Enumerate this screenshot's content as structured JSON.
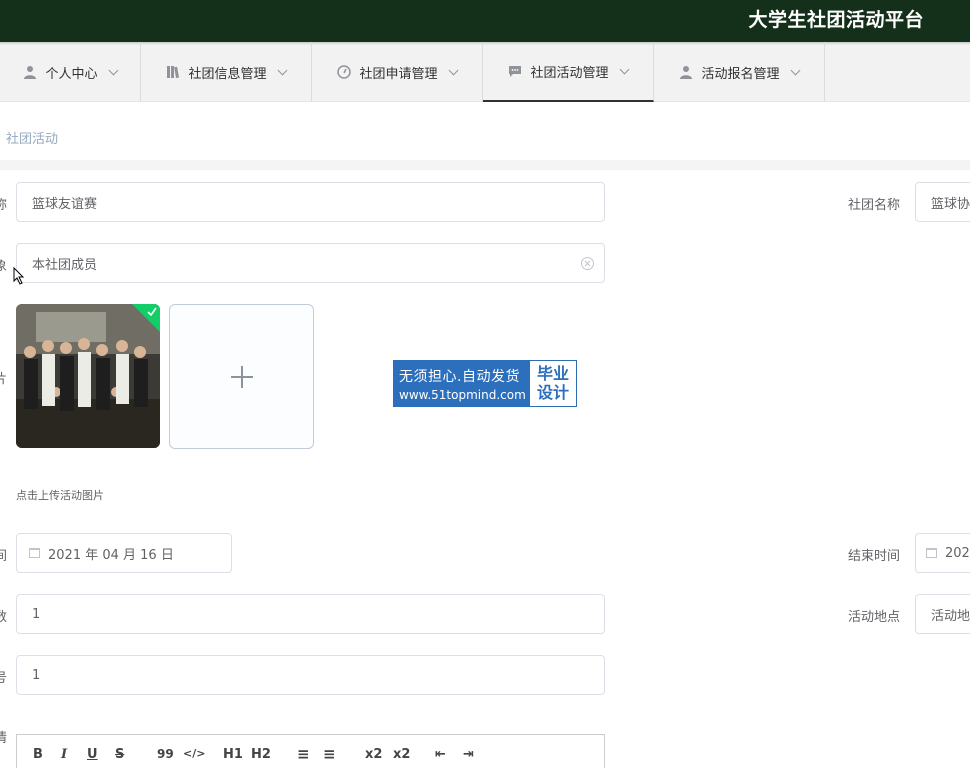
{
  "app": {
    "title": "大学生社团活动平台"
  },
  "nav": {
    "items": [
      {
        "label": "个人中心",
        "icon": "user-icon"
      },
      {
        "label": "社团信息管理",
        "icon": "book-icon"
      },
      {
        "label": "社团申请管理",
        "icon": "gauge-icon"
      },
      {
        "label": "社团活动管理",
        "icon": "chat-icon",
        "active": true
      },
      {
        "label": "活动报名管理",
        "icon": "user-icon"
      }
    ]
  },
  "breadcrumb": {
    "current": "社团活动"
  },
  "form": {
    "activity_name": {
      "label": "称",
      "value": "篮球友谊赛"
    },
    "club_name": {
      "label": "社团名称",
      "value": "篮球协"
    },
    "target": {
      "label": "象",
      "value": "本社团成员"
    },
    "image": {
      "label": "片",
      "hint": "点击上传活动图片"
    },
    "start_time": {
      "label": "间",
      "value": "2021 年 04 月 16 日"
    },
    "end_time": {
      "label": "结束时间",
      "value": "202"
    },
    "count": {
      "label": "数",
      "value": "1"
    },
    "location": {
      "label": "活动地点",
      "value": "活动地"
    },
    "number": {
      "label": "号",
      "value": "1"
    },
    "detail": {
      "label": "情"
    }
  },
  "watermark": {
    "line1": "无须担心.自动发货",
    "line2": "www.51topmind.com",
    "badge_line1": "毕业",
    "badge_line2": "设计"
  },
  "editor_toolbar": [
    {
      "name": "bold",
      "glyph": "B"
    },
    {
      "name": "italic",
      "glyph": "I"
    },
    {
      "name": "underline",
      "glyph": "U"
    },
    {
      "name": "strike",
      "glyph": "S"
    },
    {
      "name": "blockquote",
      "glyph": "99"
    },
    {
      "name": "code",
      "glyph": "</>"
    },
    {
      "name": "h1",
      "glyph": "H1"
    },
    {
      "name": "h2",
      "glyph": "H2"
    },
    {
      "name": "ordered-list",
      "glyph": "≡"
    },
    {
      "name": "bullet-list",
      "glyph": "≡"
    },
    {
      "name": "subscript",
      "glyph": "x2"
    },
    {
      "name": "superscript",
      "glyph": "x2"
    },
    {
      "name": "outdent",
      "glyph": "⇤"
    },
    {
      "name": "indent",
      "glyph": "⇥"
    }
  ]
}
